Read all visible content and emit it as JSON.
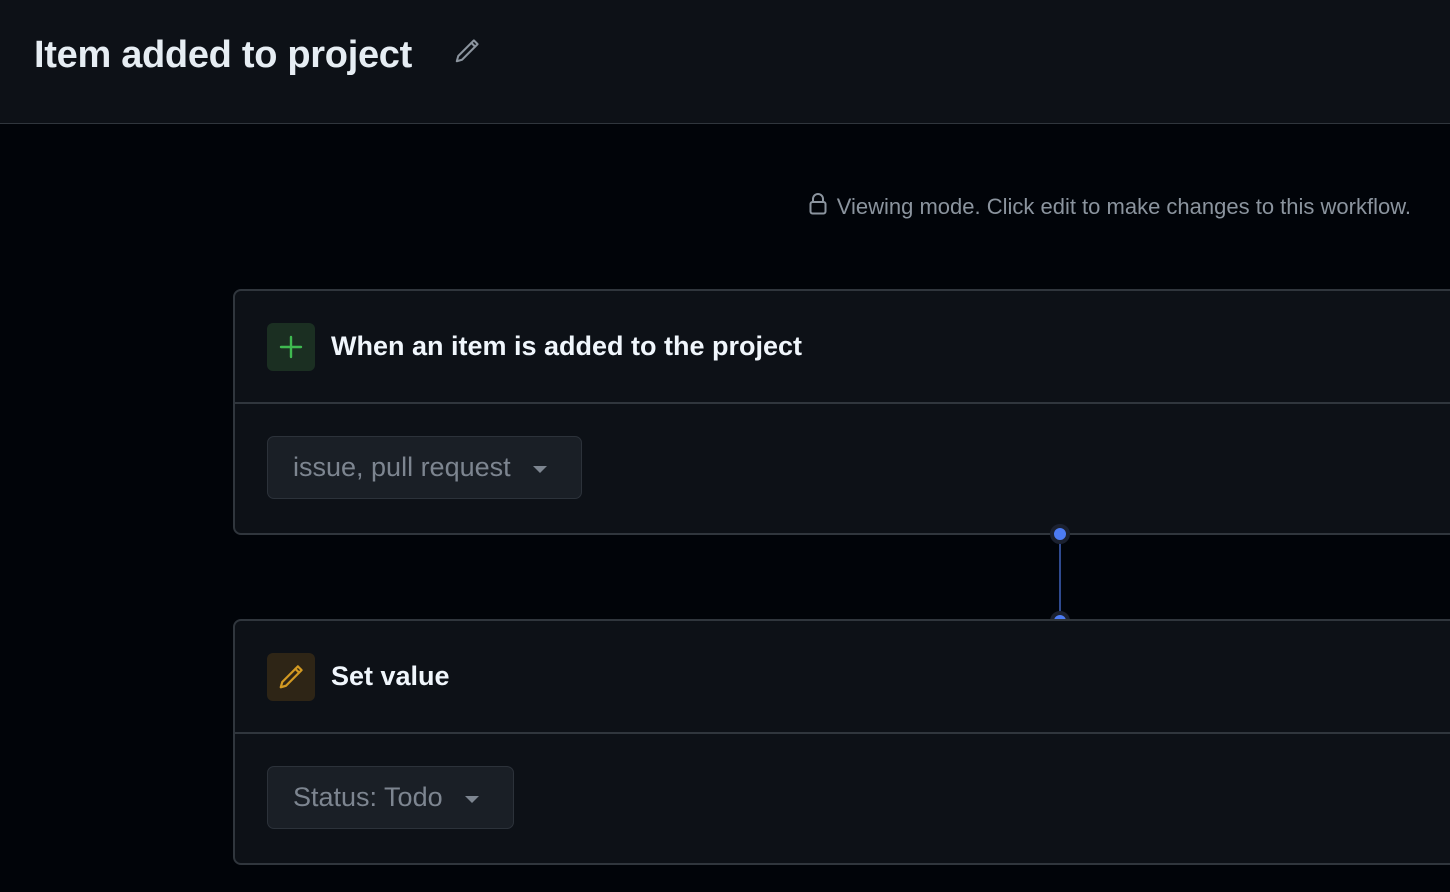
{
  "header": {
    "title": "Item added to project",
    "edit_icon": "pencil-icon"
  },
  "notice": {
    "icon": "lock-icon",
    "text": "Viewing mode. Click edit to make changes to this workflow."
  },
  "trigger": {
    "icon": "plus-icon",
    "icon_color": "#3fb950",
    "title": "When an item is added to the project",
    "select_value": "issue, pull request"
  },
  "action": {
    "icon": "pencil-icon",
    "icon_color": "#d29922",
    "title": "Set value",
    "select_value": "Status: Todo"
  },
  "colors": {
    "background": "#010409",
    "card": "#0d1117",
    "border": "#30363d",
    "connector": "#4c7bf3"
  }
}
